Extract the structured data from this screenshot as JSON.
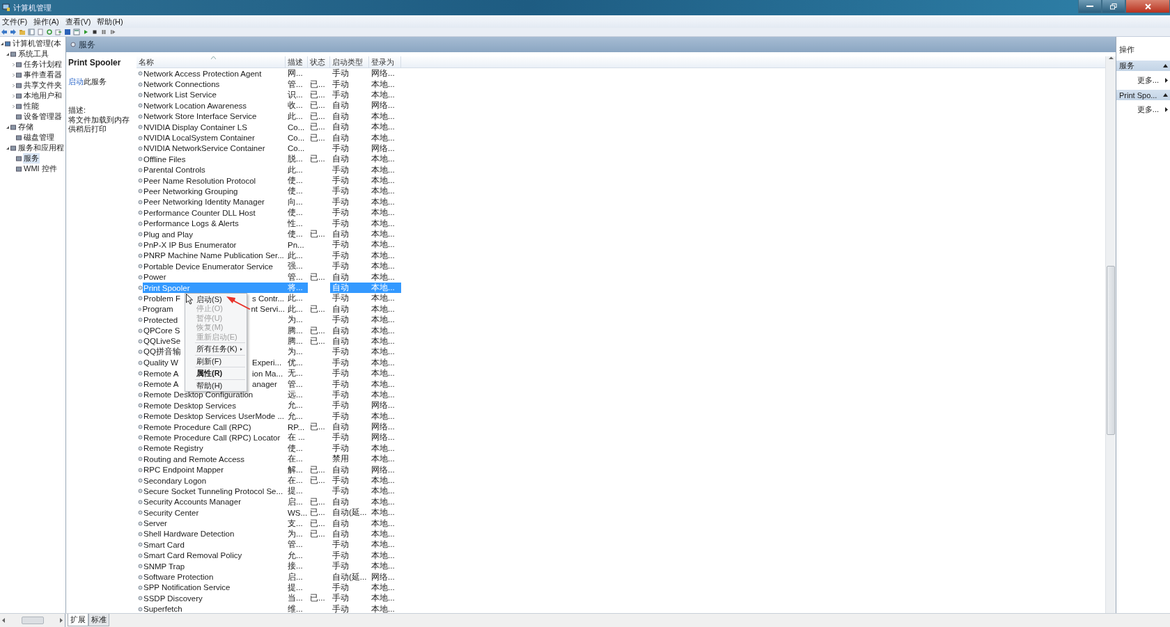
{
  "window": {
    "title": "计算机管理"
  },
  "menu": [
    "文件(F)",
    "操作(A)",
    "查看(V)",
    "帮助(H)"
  ],
  "tree": [
    {
      "label": "计算机管理(本",
      "expanded": true,
      "selected": false,
      "children": [
        {
          "label": "系统工具",
          "expanded": true,
          "selected": false,
          "children": [
            {
              "label": "任务计划程",
              "expanded": false,
              "selected": false
            },
            {
              "label": "事件查看器",
              "expanded": false,
              "selected": false
            },
            {
              "label": "共享文件夹",
              "expanded": false,
              "selected": false
            },
            {
              "label": "本地用户和",
              "expanded": false,
              "selected": false
            },
            {
              "label": "性能",
              "expanded": false,
              "selected": false
            },
            {
              "label": "设备管理器",
              "selected": false
            }
          ]
        },
        {
          "label": "存储",
          "expanded": true,
          "selected": false,
          "children": [
            {
              "label": "磁盘管理",
              "selected": false
            }
          ]
        },
        {
          "label": "服务和应用程",
          "expanded": true,
          "selected": false,
          "children": [
            {
              "label": "服务",
              "selected": true
            },
            {
              "label": "WMI 控件",
              "selected": false
            }
          ]
        }
      ]
    }
  ],
  "panel_title": "服务",
  "details": {
    "title": "Print Spooler",
    "action_link": "启动",
    "action_text": "此服务",
    "description_label": "描述:",
    "description": "将文件加载到内存供稍后打印"
  },
  "table": {
    "columns": [
      {
        "label": "名称",
        "sorted": true
      },
      {
        "label": "描述",
        "sorted": false
      },
      {
        "label": "状态",
        "sorted": false
      },
      {
        "label": "启动类型",
        "sorted": false
      },
      {
        "label": "登录为",
        "sorted": false
      }
    ],
    "rows": [
      {
        "name": "Network Access Protection Agent",
        "description": "网...",
        "start_type": "手动",
        "logon": "网络...",
        "selected": false
      },
      {
        "name": "Network Connections",
        "description": "管...",
        "status": "已...",
        "start_type": "手动",
        "logon": "本地...",
        "selected": false
      },
      {
        "name": "Network List Service",
        "description": "识...",
        "status": "已...",
        "start_type": "手动",
        "logon": "本地...",
        "selected": false
      },
      {
        "name": "Network Location Awareness",
        "description": "收...",
        "status": "已...",
        "start_type": "自动",
        "logon": "网络...",
        "selected": false
      },
      {
        "name": "Network Store Interface Service",
        "description": "此...",
        "status": "已...",
        "start_type": "自动",
        "logon": "本地...",
        "selected": false
      },
      {
        "name": "NVIDIA Display Container LS",
        "description": "Co...",
        "status": "已...",
        "start_type": "自动",
        "logon": "本地...",
        "selected": false
      },
      {
        "name": "NVIDIA LocalSystem Container",
        "description": "Co...",
        "status": "已...",
        "start_type": "自动",
        "logon": "本地...",
        "selected": false
      },
      {
        "name": "NVIDIA NetworkService Container",
        "description": "Co...",
        "start_type": "手动",
        "logon": "网络...",
        "selected": false
      },
      {
        "name": "Offline Files",
        "description": "脱...",
        "status": "已...",
        "start_type": "自动",
        "logon": "本地...",
        "selected": false
      },
      {
        "name": "Parental Controls",
        "description": "此...",
        "start_type": "手动",
        "logon": "本地...",
        "selected": false
      },
      {
        "name": "Peer Name Resolution Protocol",
        "description": "使...",
        "start_type": "手动",
        "logon": "本地...",
        "selected": false
      },
      {
        "name": "Peer Networking Grouping",
        "description": "使...",
        "start_type": "手动",
        "logon": "本地...",
        "selected": false
      },
      {
        "name": "Peer Networking Identity Manager",
        "description": "向...",
        "start_type": "手动",
        "logon": "本地...",
        "selected": false
      },
      {
        "name": "Performance Counter DLL Host",
        "description": "使...",
        "start_type": "手动",
        "logon": "本地...",
        "selected": false
      },
      {
        "name": "Performance Logs & Alerts",
        "description": "性...",
        "start_type": "手动",
        "logon": "本地...",
        "selected": false
      },
      {
        "name": "Plug and Play",
        "description": "使...",
        "status": "已...",
        "start_type": "自动",
        "logon": "本地...",
        "selected": false
      },
      {
        "name": "PnP-X IP Bus Enumerator",
        "description": "Pn...",
        "start_type": "手动",
        "logon": "本地...",
        "selected": false
      },
      {
        "name": "PNRP Machine Name Publication Ser...",
        "description": "此...",
        "start_type": "手动",
        "logon": "本地...",
        "selected": false
      },
      {
        "name": "Portable Device Enumerator Service",
        "description": "强...",
        "start_type": "手动",
        "logon": "本地...",
        "selected": false
      },
      {
        "name": "Power",
        "description": "管...",
        "status": "已...",
        "start_type": "自动",
        "logon": "本地...",
        "selected": false
      },
      {
        "name": "Print Spooler",
        "description": "将...",
        "start_type": "自动",
        "logon": "本地...",
        "selected": true
      },
      {
        "name": "Problem F",
        "name_after_menu": "s Contr...",
        "description": "此...",
        "start_type": "手动",
        "logon": "本地...",
        "selected": false
      },
      {
        "name": "Program",
        "name_after_menu": "nt Servi...",
        "description": "此...",
        "status": "已...",
        "start_type": "自动",
        "logon": "本地...",
        "selected": false
      },
      {
        "name": "Protected",
        "description": "为...",
        "start_type": "手动",
        "logon": "本地...",
        "selected": false
      },
      {
        "name": "QPCore S",
        "description": "腾...",
        "status": "已...",
        "start_type": "自动",
        "logon": "本地...",
        "selected": false
      },
      {
        "name": "QQLiveSe",
        "description": "腾...",
        "status": "已...",
        "start_type": "自动",
        "logon": "本地...",
        "selected": false
      },
      {
        "name": "QQ拼音输",
        "description": "为...",
        "start_type": "手动",
        "logon": "本地...",
        "selected": false
      },
      {
        "name": "Quality W",
        "name_after_menu": "Experi...",
        "description": "优...",
        "start_type": "手动",
        "logon": "本地...",
        "selected": false
      },
      {
        "name": "Remote A",
        "name_after_menu": "ion Ma...",
        "description": "无...",
        "start_type": "手动",
        "logon": "本地...",
        "selected": false
      },
      {
        "name": "Remote A",
        "name_after_menu": "anager",
        "description": "管...",
        "start_type": "手动",
        "logon": "本地...",
        "selected": false
      },
      {
        "name": "Remote Desktop Configuration",
        "description": "远...",
        "start_type": "手动",
        "logon": "本地...",
        "selected": false
      },
      {
        "name": "Remote Desktop Services",
        "description": "允...",
        "start_type": "手动",
        "logon": "网络...",
        "selected": false
      },
      {
        "name": "Remote Desktop Services UserMode ...",
        "description": "允...",
        "start_type": "手动",
        "logon": "本地...",
        "selected": false
      },
      {
        "name": "Remote Procedure Call (RPC)",
        "description": "RP...",
        "status": "已...",
        "start_type": "自动",
        "logon": "网络...",
        "selected": false
      },
      {
        "name": "Remote Procedure Call (RPC) Locator",
        "description": "在 ...",
        "start_type": "手动",
        "logon": "网络...",
        "selected": false
      },
      {
        "name": "Remote Registry",
        "description": "使...",
        "start_type": "手动",
        "logon": "本地...",
        "selected": false
      },
      {
        "name": "Routing and Remote Access",
        "description": "在...",
        "start_type": "禁用",
        "logon": "本地...",
        "selected": false
      },
      {
        "name": "RPC Endpoint Mapper",
        "description": "解...",
        "status": "已...",
        "start_type": "自动",
        "logon": "网络...",
        "selected": false
      },
      {
        "name": "Secondary Logon",
        "description": "在...",
        "status": "已...",
        "start_type": "手动",
        "logon": "本地...",
        "selected": false
      },
      {
        "name": "Secure Socket Tunneling Protocol Se...",
        "description": "提...",
        "start_type": "手动",
        "logon": "本地...",
        "selected": false
      },
      {
        "name": "Security Accounts Manager",
        "description": "启...",
        "status": "已...",
        "start_type": "自动",
        "logon": "本地...",
        "selected": false
      },
      {
        "name": "Security Center",
        "description": "WS...",
        "status": "已...",
        "start_type": "自动(延...",
        "logon": "本地...",
        "selected": false
      },
      {
        "name": "Server",
        "description": "支...",
        "status": "已...",
        "start_type": "自动",
        "logon": "本地...",
        "selected": false
      },
      {
        "name": "Shell Hardware Detection",
        "description": "为...",
        "status": "已...",
        "start_type": "自动",
        "logon": "本地...",
        "selected": false
      },
      {
        "name": "Smart Card",
        "description": "管...",
        "start_type": "手动",
        "logon": "本地...",
        "selected": false
      },
      {
        "name": "Smart Card Removal Policy",
        "description": "允...",
        "start_type": "手动",
        "logon": "本地...",
        "selected": false
      },
      {
        "name": "SNMP Trap",
        "description": "接...",
        "start_type": "手动",
        "logon": "本地...",
        "selected": false
      },
      {
        "name": "Software Protection",
        "description": "启...",
        "start_type": "自动(延...",
        "logon": "网络...",
        "selected": false
      },
      {
        "name": "SPP Notification Service",
        "description": "提...",
        "start_type": "手动",
        "logon": "本地...",
        "selected": false
      },
      {
        "name": "SSDP Discovery",
        "description": "当...",
        "status": "已...",
        "start_type": "手动",
        "logon": "本地...",
        "selected": false
      },
      {
        "name": "Superfetch",
        "description": "维...",
        "start_type": "手动",
        "logon": "本地...",
        "selected": false
      }
    ]
  },
  "context_menu": {
    "items": [
      {
        "kind": "item",
        "label": "启动(S)",
        "disabled": false,
        "submenu": false,
        "default": false
      },
      {
        "kind": "item",
        "label": "停止(O)",
        "disabled": true,
        "submenu": false,
        "default": false
      },
      {
        "kind": "item",
        "label": "暂停(U)",
        "disabled": true,
        "submenu": false,
        "default": false
      },
      {
        "kind": "item",
        "label": "恢复(M)",
        "disabled": true,
        "submenu": false,
        "default": false
      },
      {
        "kind": "item",
        "label": "重新启动(E)",
        "disabled": true,
        "submenu": false,
        "default": false
      },
      {
        "kind": "separator"
      },
      {
        "kind": "item",
        "label": "所有任务(K)",
        "disabled": false,
        "submenu": true,
        "default": false
      },
      {
        "kind": "separator"
      },
      {
        "kind": "item",
        "label": "刷新(F)",
        "disabled": false,
        "submenu": false,
        "default": false
      },
      {
        "kind": "separator"
      },
      {
        "kind": "item",
        "label": "属性(R)",
        "disabled": false,
        "submenu": false,
        "default": true
      },
      {
        "kind": "separator"
      },
      {
        "kind": "item",
        "label": "帮助(H)",
        "disabled": false,
        "submenu": false,
        "default": false
      }
    ]
  },
  "actions": {
    "title": "操作",
    "sections": [
      {
        "title": "服务",
        "expanded": true,
        "items": [
          "更多..."
        ]
      },
      {
        "title": "Print Spo...",
        "expanded": true,
        "items": [
          "更多..."
        ]
      }
    ]
  },
  "bottom_tabs": [
    {
      "label": "扩展",
      "selected": true
    },
    {
      "label": "标准",
      "selected": false
    }
  ]
}
